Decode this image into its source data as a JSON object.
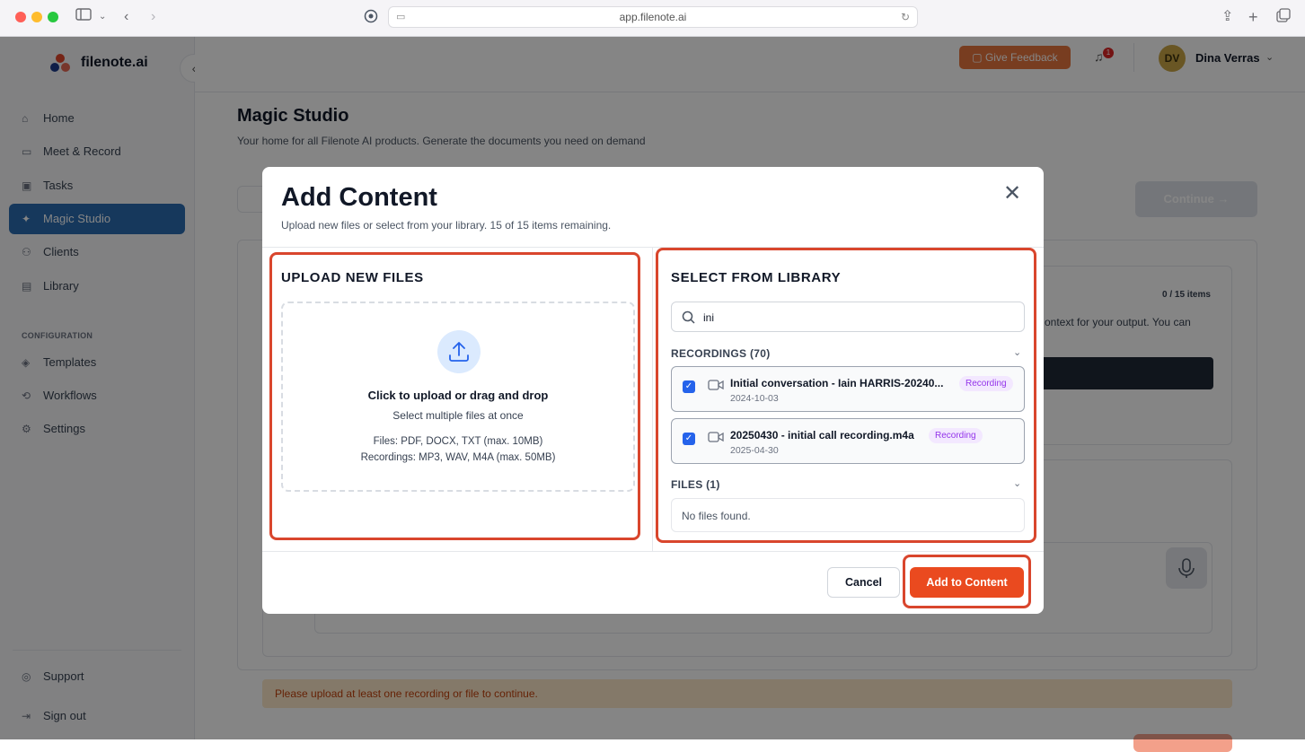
{
  "browser": {
    "url": "app.filenote.ai"
  },
  "app": {
    "name": "filenote.ai"
  },
  "sidebar": {
    "items": [
      {
        "label": "Home",
        "icon": "home-icon"
      },
      {
        "label": "Meet & Record",
        "icon": "video-icon"
      },
      {
        "label": "Tasks",
        "icon": "briefcase-icon"
      },
      {
        "label": "Magic Studio",
        "icon": "magic-wand-icon",
        "active": true
      },
      {
        "label": "Clients",
        "icon": "users-icon"
      },
      {
        "label": "Library",
        "icon": "document-icon"
      }
    ],
    "config_label": "CONFIGURATION",
    "config_items": [
      {
        "label": "Templates",
        "icon": "layers-icon"
      },
      {
        "label": "Workflows",
        "icon": "workflow-icon"
      },
      {
        "label": "Settings",
        "icon": "gear-icon"
      }
    ],
    "bottom_items": [
      {
        "label": "Support",
        "icon": "lifebuoy-icon"
      },
      {
        "label": "Sign out",
        "icon": "logout-icon"
      }
    ]
  },
  "header": {
    "feedback_label": "Give Feedback",
    "notification_count": "1",
    "user_initials": "DV",
    "user_name": "Dina Verras"
  },
  "page": {
    "title": "Magic Studio",
    "subtitle": "Your home for all Filenote AI products. Generate the documents you need on demand",
    "continue_label": "Continue →",
    "counter": "0 / 15 items",
    "hint": "ontext for your output. You can",
    "warning": "Please upload at least one recording or file to continue."
  },
  "modal": {
    "title": "Add Content",
    "subtitle": "Upload new files or select from your library. 15 of 15 items remaining.",
    "upload": {
      "heading": "UPLOAD NEW FILES",
      "drop_title": "Click to upload or drag and drop",
      "drop_sub": "Select multiple files at once",
      "files_info": "Files: PDF, DOCX, TXT (max. 10MB)",
      "recordings_info": "Recordings: MP3, WAV, M4A (max. 50MB)"
    },
    "library": {
      "heading": "SELECT FROM LIBRARY",
      "search_value": "ini",
      "recordings_header": "RECORDINGS (70)",
      "recordings": [
        {
          "name": "Initial conversation - Iain HARRIS-20240...",
          "date": "2024-10-03",
          "tag": "Recording",
          "checked": true
        },
        {
          "name": "20250430 - initial call recording.m4a",
          "date": "2025-04-30",
          "tag": "Recording",
          "checked": true
        }
      ],
      "files_header": "FILES (1)",
      "no_files": "No files found."
    },
    "cancel_label": "Cancel",
    "add_label": "Add to Content"
  }
}
